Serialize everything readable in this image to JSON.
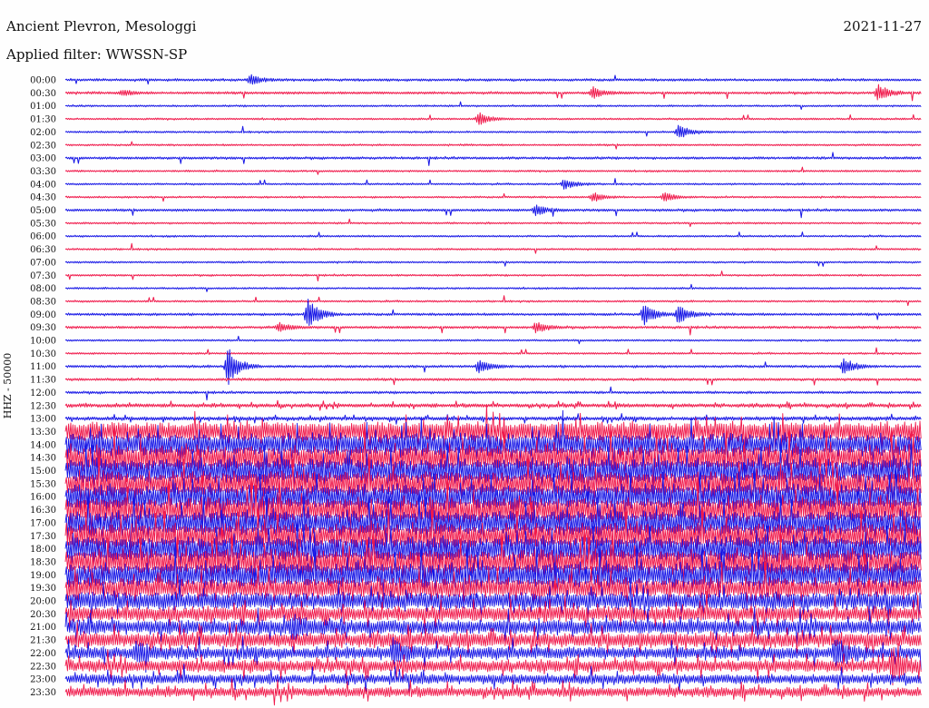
{
  "header": {
    "station": "Ancient Plevron, Mesologgi",
    "date": "2021-11-27",
    "filter_prefix": "Applied filter: ",
    "filter_name": "WWSSN-SP"
  },
  "colors": {
    "blue": "#1616e6",
    "red": "#f0184a",
    "background": "#fefefe"
  },
  "chart_data": {
    "type": "line",
    "subtype": "helicorder",
    "title": "Ancient Plevron, Mesologgi",
    "ylabel": "HHZ - 50000",
    "row_minutes": 30,
    "series_colors": [
      "blue",
      "red"
    ],
    "time_labels": [
      "00:00",
      "00:30",
      "01:00",
      "01:30",
      "02:00",
      "02:30",
      "03:00",
      "03:30",
      "04:00",
      "04:30",
      "05:00",
      "05:30",
      "06:00",
      "06:30",
      "07:00",
      "07:30",
      "08:00",
      "08:30",
      "09:00",
      "09:30",
      "10:00",
      "10:30",
      "11:00",
      "11:30",
      "12:00",
      "12:30",
      "13:00",
      "13:30",
      "14:00",
      "14:30",
      "15:00",
      "15:30",
      "16:00",
      "16:30",
      "17:00",
      "17:30",
      "18:00",
      "18:30",
      "19:00",
      "19:30",
      "20:00",
      "20:30",
      "21:00",
      "21:30",
      "22:00",
      "22:30",
      "23:00",
      "23:30"
    ],
    "row_amplitude": [
      2,
      2,
      1.5,
      1.5,
      1.5,
      1.5,
      2,
      1.5,
      1.5,
      1.5,
      2,
      1.5,
      1.5,
      1.5,
      1.5,
      1.5,
      1.5,
      1.5,
      2,
      2,
      1.5,
      1.5,
      2,
      2,
      2,
      3,
      3,
      16,
      18,
      20,
      20,
      20,
      20,
      20,
      20,
      20,
      20,
      20,
      20,
      16,
      14,
      12,
      12,
      12,
      10,
      10,
      8,
      8
    ],
    "events": [
      {
        "row": 0,
        "minute": 6.5,
        "strength": 5
      },
      {
        "row": 1,
        "minute": 2,
        "strength": 3
      },
      {
        "row": 1,
        "minute": 18.5,
        "strength": 6
      },
      {
        "row": 1,
        "minute": 28.5,
        "strength": 9
      },
      {
        "row": 3,
        "minute": 14.5,
        "strength": 7
      },
      {
        "row": 4,
        "minute": 21.5,
        "strength": 8
      },
      {
        "row": 8,
        "minute": 17.5,
        "strength": 6
      },
      {
        "row": 9,
        "minute": 18.5,
        "strength": 5
      },
      {
        "row": 9,
        "minute": 21,
        "strength": 5
      },
      {
        "row": 10,
        "minute": 16.5,
        "strength": 6
      },
      {
        "row": 18,
        "minute": 8.5,
        "strength": 18
      },
      {
        "row": 18,
        "minute": 20.3,
        "strength": 12
      },
      {
        "row": 18,
        "minute": 21.5,
        "strength": 11
      },
      {
        "row": 19,
        "minute": 7.5,
        "strength": 5
      },
      {
        "row": 19,
        "minute": 16.5,
        "strength": 6
      },
      {
        "row": 22,
        "minute": 5.7,
        "strength": 22
      },
      {
        "row": 22,
        "minute": 14.5,
        "strength": 7
      },
      {
        "row": 22,
        "minute": 27.3,
        "strength": 9
      },
      {
        "row": 42,
        "minute": 8,
        "strength": 10
      },
      {
        "row": 44,
        "minute": 2.5,
        "strength": 12
      },
      {
        "row": 44,
        "minute": 11.5,
        "strength": 12
      },
      {
        "row": 44,
        "minute": 27,
        "strength": 14
      },
      {
        "row": 45,
        "minute": 29,
        "strength": 16
      }
    ]
  }
}
